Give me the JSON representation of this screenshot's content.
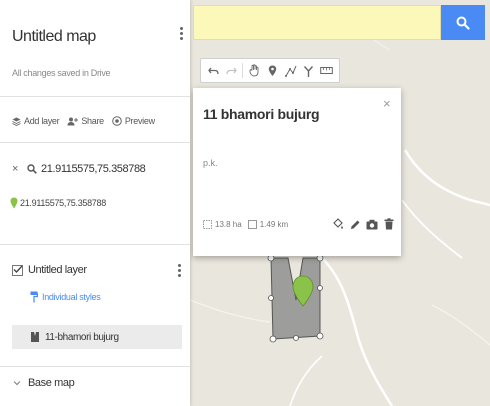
{
  "panel": {
    "map_title": "Untitled map",
    "save_status": "All changes saved in Drive",
    "actions": {
      "add_layer": "Add layer",
      "share": "Share",
      "preview": "Preview"
    },
    "search_result": {
      "query": "21.9115575,75.358788",
      "item_label": "21.9115575,75.358788"
    },
    "layer": {
      "name": "Untitled layer",
      "style_label": "Individual styles",
      "feature_label": "11-bhamori bujurg"
    },
    "base_map_label": "Base map"
  },
  "popup": {
    "title": "11 bhamori bujurg",
    "description": "p.k.",
    "area": "13.8 ha",
    "perimeter": "1.49 km",
    "close_glyph": "×"
  },
  "colors": {
    "search_bg": "#fcf8b9",
    "search_button": "#4a8af4",
    "link_blue": "#4a8af4",
    "marker_green": "#8bc34a",
    "polygon_fill": "#8f8f8f"
  }
}
